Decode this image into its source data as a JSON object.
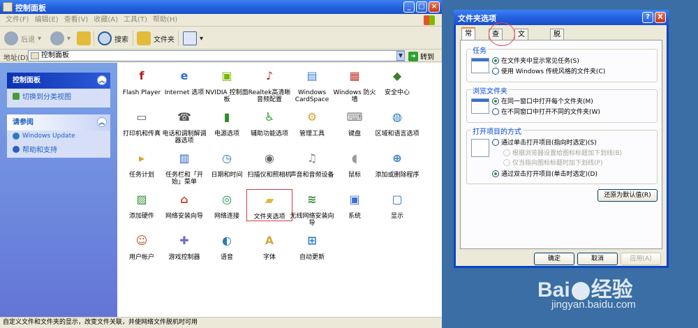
{
  "cp": {
    "title": "控制面板",
    "menu": [
      "文件(F)",
      "编辑(E)",
      "查看(V)",
      "收藏(A)",
      "工具(T)",
      "帮助(H)"
    ],
    "toolbar": {
      "back": "后退",
      "search": "搜索",
      "folders": "文件夹"
    },
    "address": {
      "label": "地址(D)",
      "value": "控制面板",
      "go": "转到"
    },
    "sidebar": {
      "panel1": {
        "title": "控制面板",
        "link": "切换到分类视图"
      },
      "panel2": {
        "title": "请参阅",
        "links": [
          "Windows Update",
          "帮助和支持"
        ]
      }
    },
    "items": [
      {
        "label": "Flash Player",
        "color": "#c0171a",
        "glyph": "f"
      },
      {
        "label": "Internet 选项",
        "color": "#2d6dd3",
        "glyph": "e"
      },
      {
        "label": "NVIDIA 控制面板",
        "color": "#76b900",
        "glyph": "▣"
      },
      {
        "label": "Realtek高清晰音频配置",
        "color": "#b22a1a",
        "glyph": "♪"
      },
      {
        "label": "Windows CardSpace",
        "color": "#3a7bd5",
        "glyph": "▤"
      },
      {
        "label": "Windows 防火墙",
        "color": "#c0392b",
        "glyph": "▦"
      },
      {
        "label": "安全中心",
        "color": "#3f7f2b",
        "glyph": "◆"
      },
      {
        "label": "打印机和传真",
        "color": "#666666",
        "glyph": "▭"
      },
      {
        "label": "电话和调制解调器选项",
        "color": "#555555",
        "glyph": "☎"
      },
      {
        "label": "电源选项",
        "color": "#2f8b2f",
        "glyph": "▮"
      },
      {
        "label": "辅助功能选项",
        "color": "#2ca02c",
        "glyph": "♿"
      },
      {
        "label": "管理工具",
        "color": "#d3a52f",
        "glyph": "⚙"
      },
      {
        "label": "键盘",
        "color": "#7a7a7a",
        "glyph": "⌨"
      },
      {
        "label": "区域和语言选项",
        "color": "#1f7bc0",
        "glyph": "◍"
      },
      {
        "label": "任务计划",
        "color": "#d9a32a",
        "glyph": "▸"
      },
      {
        "label": "任务栏和「开始」菜单",
        "color": "#2a5fc7",
        "glyph": "▥"
      },
      {
        "label": "日期和时间",
        "color": "#2f6fce",
        "glyph": "◷"
      },
      {
        "label": "扫描仪和照相机",
        "color": "#666666",
        "glyph": "◉"
      },
      {
        "label": "声音和音频设备",
        "color": "#808080",
        "glyph": "♫"
      },
      {
        "label": "鼠标",
        "color": "#999999",
        "glyph": "◖"
      },
      {
        "label": "添加或删除程序",
        "color": "#3079c4",
        "glyph": "⊕"
      },
      {
        "label": "添加硬件",
        "color": "#3a8a3a",
        "glyph": "▨"
      },
      {
        "label": "网络安装向导",
        "color": "#c6462b",
        "glyph": "⌂"
      },
      {
        "label": "网络连接",
        "color": "#1f8a54",
        "glyph": "◎"
      },
      {
        "label": "文件夹选项",
        "color": "#e3b83a",
        "glyph": "▰"
      },
      {
        "label": "无线网络安装向导",
        "color": "#3a8a3a",
        "glyph": "≋"
      },
      {
        "label": "系统",
        "color": "#3a6fd0",
        "glyph": "▣"
      },
      {
        "label": "显示",
        "color": "#2a69c9",
        "glyph": "▢"
      },
      {
        "label": "用户帐户",
        "color": "#c1532b",
        "glyph": "☺"
      },
      {
        "label": "游戏控制器",
        "color": "#6b6bc9",
        "glyph": "✚"
      },
      {
        "label": "语音",
        "color": "#2a7ac2",
        "glyph": "◐"
      },
      {
        "label": "字体",
        "color": "#d7a93b",
        "glyph": "A"
      },
      {
        "label": "自动更新",
        "color": "#2a7ac2",
        "glyph": "⊞"
      }
    ],
    "status": "自定义文件和文件夹的显示，改变文件关联，并使网络文件脱机时可用"
  },
  "dlg": {
    "title": "文件夹选项",
    "help": "?",
    "close": "X",
    "tabs": [
      "常规",
      "查看",
      "文件类型",
      "脱机文件"
    ],
    "group1": {
      "label": "任务",
      "opt1": "在文件夹中显示常见任务(S)",
      "opt2": "使用 Windows 传统风格的文件夹(C)"
    },
    "group2": {
      "label": "浏览文件夹",
      "opt1": "在同一窗口中打开每个文件夹(M)",
      "opt2": "在不同窗口中打开不同的文件夹(W)"
    },
    "group3": {
      "label": "打开项目的方式",
      "opt1": "通过单击打开项目(指向时选定)(S)",
      "sub1": "根据浏览器设置给图标标题加下划线(B)",
      "sub2": "仅当指向图标标题时加下划线(P)",
      "opt2": "通过双击打开项目(单击时选定)(D)"
    },
    "restore": "还原为默认值(R)",
    "ok": "确定",
    "cancel": "取消",
    "apply": "应用(A)"
  },
  "watermark": {
    "brand_left": "Bai",
    "brand_right": "经验",
    "url": "jingyan.baidu.com"
  }
}
